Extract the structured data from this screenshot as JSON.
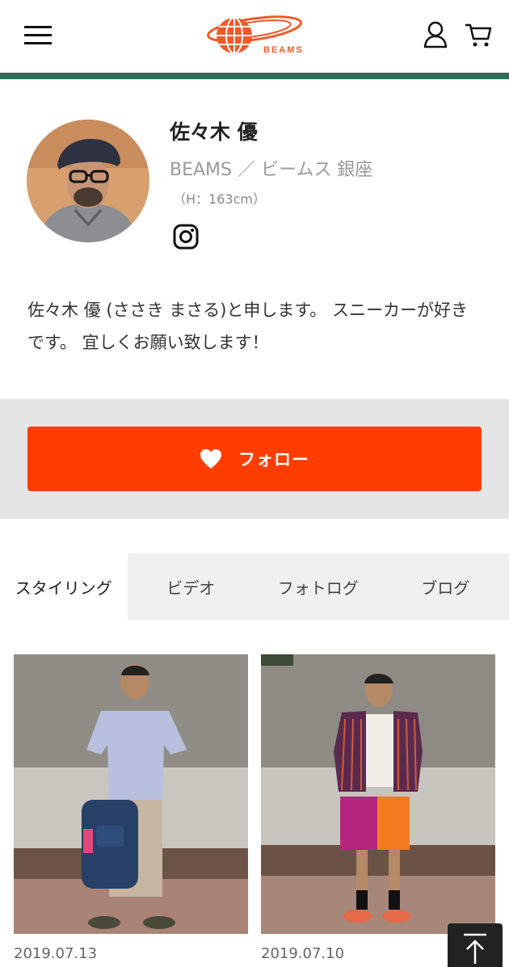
{
  "header": {
    "menu_icon": "hamburger-icon",
    "logo_text": "BEAMS",
    "user_icon": "user-icon",
    "cart_icon": "cart-icon",
    "accent_color": "#2f6d55",
    "logo_color": "#f05a28"
  },
  "profile": {
    "name": "佐々木 優",
    "shop": "BEAMS ／ ビームス 銀座",
    "height": "（H：163cm）",
    "social_icon": "instagram-icon",
    "bio": "佐々木 優 (ささき まさる)と申します。 スニーカーが好きです。 宜しくお願い致します！"
  },
  "follow": {
    "label": "フォロー",
    "icon": "heart-icon",
    "color": "#ff3d00"
  },
  "tabs": [
    {
      "label": "スタイリング",
      "active": true
    },
    {
      "label": "ビデオ",
      "active": false
    },
    {
      "label": "フォトログ",
      "active": false
    },
    {
      "label": "ブログ",
      "active": false
    }
  ],
  "stylings": [
    {
      "date": "2019.07.13"
    },
    {
      "date": "2019.07.10"
    }
  ],
  "scroll_top_icon": "arrow-up-icon"
}
